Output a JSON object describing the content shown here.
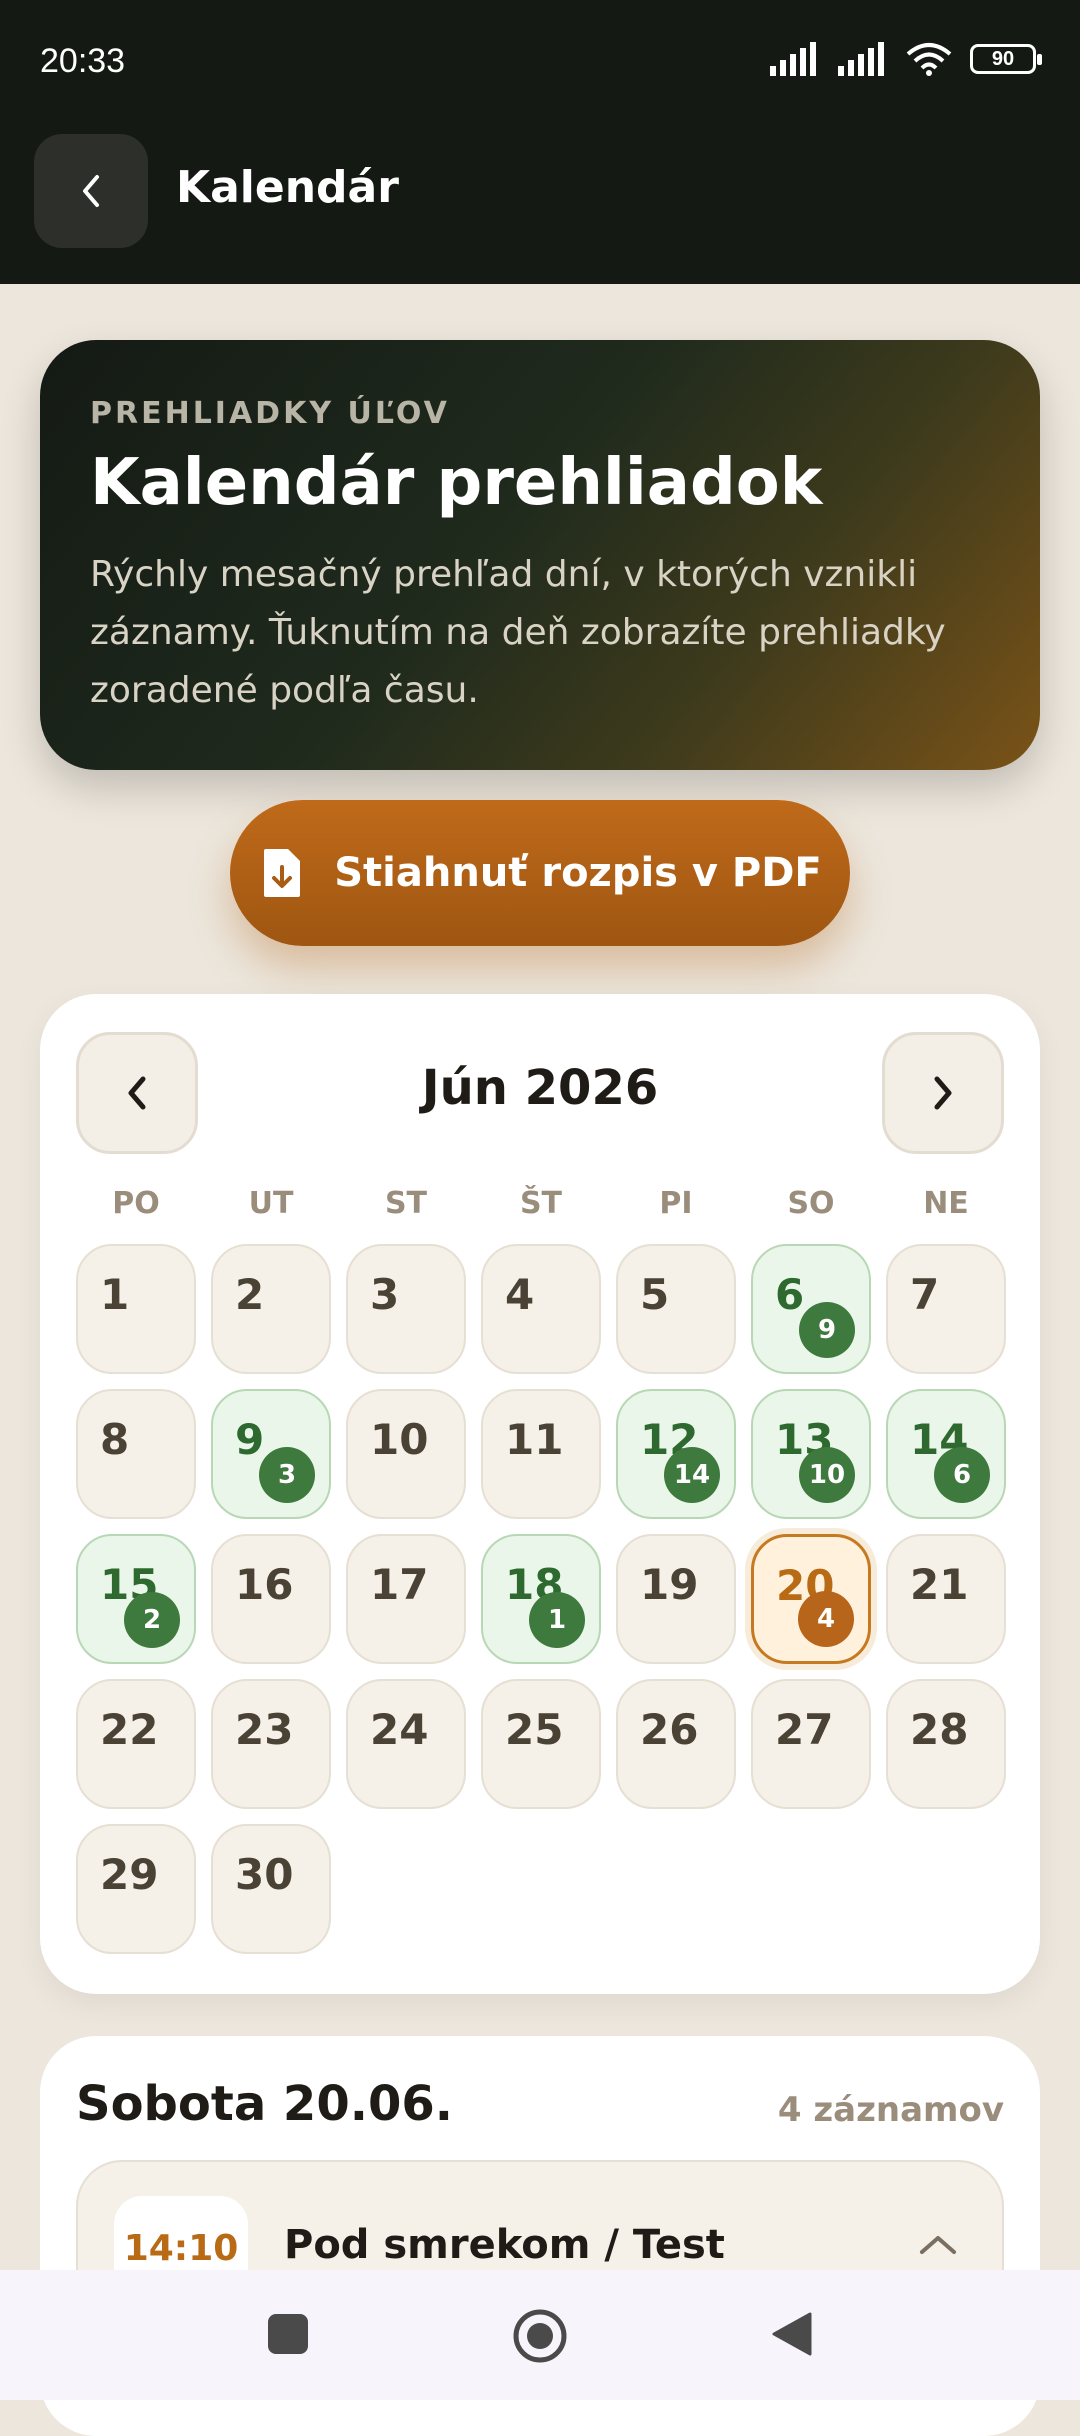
{
  "status": {
    "time": "20:33",
    "battery": "90"
  },
  "appbar": {
    "title": "Kalendár"
  },
  "hero": {
    "eyebrow": "PREHLIADKY ÚĽOV",
    "title": "Kalendár prehliadok",
    "description": "Rýchly mesačný prehľad dní, v ktorých vznikli záznamy. Ťuknutím na deň zobrazíte prehliadky zoradené podľa času."
  },
  "pdf_button": {
    "label": "Stiahnuť rozpis v PDF"
  },
  "calendar": {
    "month": "Jún 2026",
    "weekdays": [
      "PO",
      "UT",
      "ST",
      "ŠT",
      "PI",
      "SO",
      "NE"
    ],
    "days": [
      {
        "n": "1"
      },
      {
        "n": "2"
      },
      {
        "n": "3"
      },
      {
        "n": "4"
      },
      {
        "n": "5"
      },
      {
        "n": "6",
        "count": "9"
      },
      {
        "n": "7"
      },
      {
        "n": "8"
      },
      {
        "n": "9",
        "count": "3"
      },
      {
        "n": "10"
      },
      {
        "n": "11"
      },
      {
        "n": "12",
        "count": "14"
      },
      {
        "n": "13",
        "count": "10"
      },
      {
        "n": "14",
        "count": "6"
      },
      {
        "n": "15",
        "count": "2"
      },
      {
        "n": "16"
      },
      {
        "n": "17"
      },
      {
        "n": "18",
        "count": "1"
      },
      {
        "n": "19"
      },
      {
        "n": "20",
        "count": "4",
        "selected": true
      },
      {
        "n": "21"
      },
      {
        "n": "22"
      },
      {
        "n": "23"
      },
      {
        "n": "24"
      },
      {
        "n": "25"
      },
      {
        "n": "26"
      },
      {
        "n": "27"
      },
      {
        "n": "28"
      },
      {
        "n": "29"
      },
      {
        "n": "30"
      }
    ]
  },
  "list": {
    "date": "Sobota 20.06.",
    "count": "4 záznamov",
    "entries": [
      {
        "time": "14:10",
        "title": "Pod smrekom / Test"
      }
    ]
  },
  "colors": {
    "accent": "#b86a14",
    "success": "#3e7a3e",
    "dark": "#151913"
  }
}
